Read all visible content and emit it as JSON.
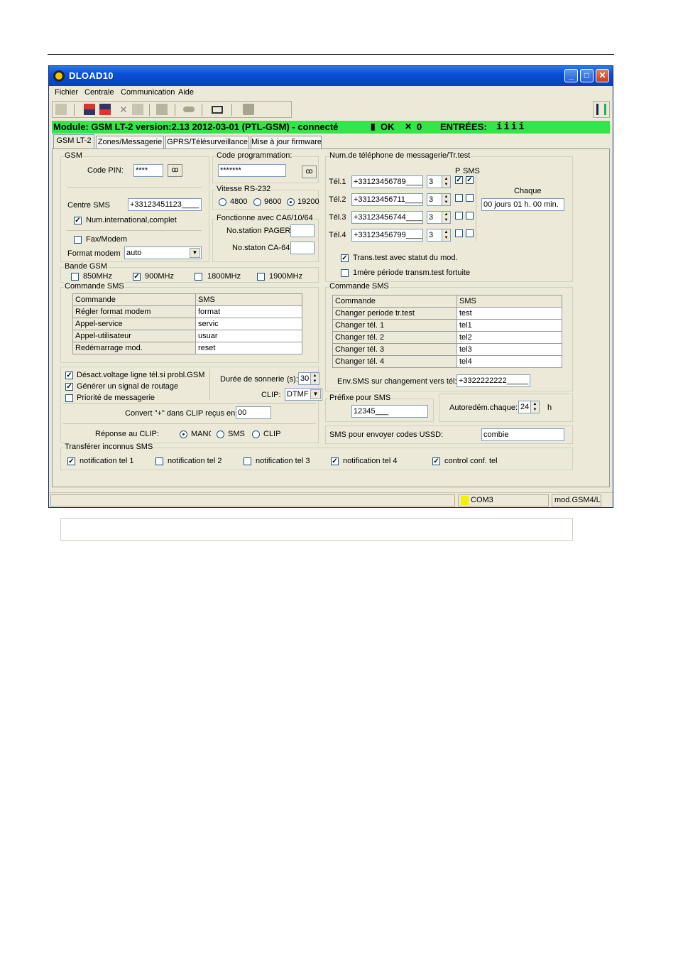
{
  "window": {
    "title": "DLOAD10"
  },
  "menu": [
    {
      "label": "Fichier"
    },
    {
      "label": "Centrale"
    },
    {
      "label": "Communication"
    },
    {
      "label": "Aide"
    }
  ],
  "status": {
    "module": "Module: GSM LT-2 version:2.13 2012-03-01 (PTL-GSM) - connecté",
    "ok": "OK",
    "zero": "0",
    "entrees": "ENTRÉES:",
    "entrees_value": "iiii"
  },
  "tabs": [
    "GSM LT-2",
    "Zones/Messagerie",
    "GPRS/Télésurveillance",
    "Mise à jour firmware"
  ],
  "gsm": {
    "title": "GSM",
    "pin_label": "Code PIN:",
    "pin_value": "****",
    "centre_label": "Centre SMS",
    "centre_value": "+33123451123____",
    "num_intl": "Num.international,complet",
    "fax_modem": "Fax/Modem",
    "format_label": "Format modem",
    "format_value": "auto"
  },
  "code_prog": {
    "title": "Code programmation:",
    "value": "*******"
  },
  "vitesse": {
    "title": "Vitesse RS-232",
    "options": [
      "4800",
      "9600",
      "19200"
    ]
  },
  "fonctionne": {
    "title": "Fonctionne avec CA6/10/64",
    "pager_label": "No.station PAGER:",
    "ca64_label": "No.staton CA-64:"
  },
  "bande": {
    "title": "Bande GSM",
    "options": [
      "850MHz",
      "900MHz",
      "1800MHz",
      "1900MHz"
    ]
  },
  "cmd_left": {
    "title": "Commande SMS",
    "headers": [
      "Commande",
      "SMS"
    ],
    "rows": [
      [
        "Régler format modem",
        "format"
      ],
      [
        "Appel-service",
        "servic"
      ],
      [
        "Appel-utilisateur",
        "usuar"
      ],
      [
        "Redémarrage mod.",
        "reset"
      ]
    ]
  },
  "options": {
    "desact": "Désact.voltage ligne tél.si probl.GSM",
    "generer": "Générer un signal de routage",
    "priorite": "Priorité de messagerie",
    "duree_label": "Durée de sonnerie",
    "duree_unit": "(s):",
    "duree_value": "30",
    "clip_label": "CLIP:",
    "clip_value": "DTMF",
    "convert_label": "Convert \"+\" dans CLIP reçus en:",
    "convert_value": "00",
    "reponse_label": "Réponse au CLIP:",
    "reponse_options": [
      "MANC",
      "SMS",
      "CLIP"
    ]
  },
  "transferer": {
    "title": "Transférer inconnus SMS",
    "items": [
      "notification tel 1",
      "notification tel 2",
      "notification tel 3",
      "notification tel 4",
      "control conf. tel"
    ]
  },
  "phones": {
    "title": "Num.de téléphone de messagerie/Tr.test",
    "p_label": "P",
    "sms_label": "SMS",
    "chaque_label": "Chaque",
    "chaque_value": "00 jours 01 h. 00 min.",
    "rows": [
      {
        "label": "Tél.1",
        "number": "+33123456789____",
        "count": "3"
      },
      {
        "label": "Tél.2",
        "number": "+33123456711____",
        "count": "3"
      },
      {
        "label": "Tél.3",
        "number": "+33123456744____",
        "count": "3"
      },
      {
        "label": "Tél.4",
        "number": "+33123456799____",
        "count": "3"
      }
    ],
    "trans_test": "Trans.test avec statut du mod.",
    "premiere": "1mère période transm.test fortuite"
  },
  "cmd_right": {
    "title": "Commande SMS",
    "headers": [
      "Commande",
      "SMS"
    ],
    "rows": [
      [
        "Changer periode tr.test",
        "test"
      ],
      [
        "Changer tél. 1",
        "tel1"
      ],
      [
        "Changer tél. 2",
        "tel2"
      ],
      [
        "Changer tél. 3",
        "tel3"
      ],
      [
        "Changer tél. 4",
        "tel4"
      ]
    ],
    "env_label": "Env.SMS sur changement vers tél:",
    "env_value": "+3322222222_____"
  },
  "prefixe": {
    "title": "Préfixe pour SMS",
    "value": "12345___"
  },
  "autoredem": {
    "label": "Autoredém.chaque:",
    "value": "24",
    "unit": "h"
  },
  "ussd": {
    "label": "SMS pour envoyer codes USSD:",
    "value": "combie"
  },
  "bottom": {
    "com": "COM3",
    "mod": "mod.GSM4/L"
  }
}
